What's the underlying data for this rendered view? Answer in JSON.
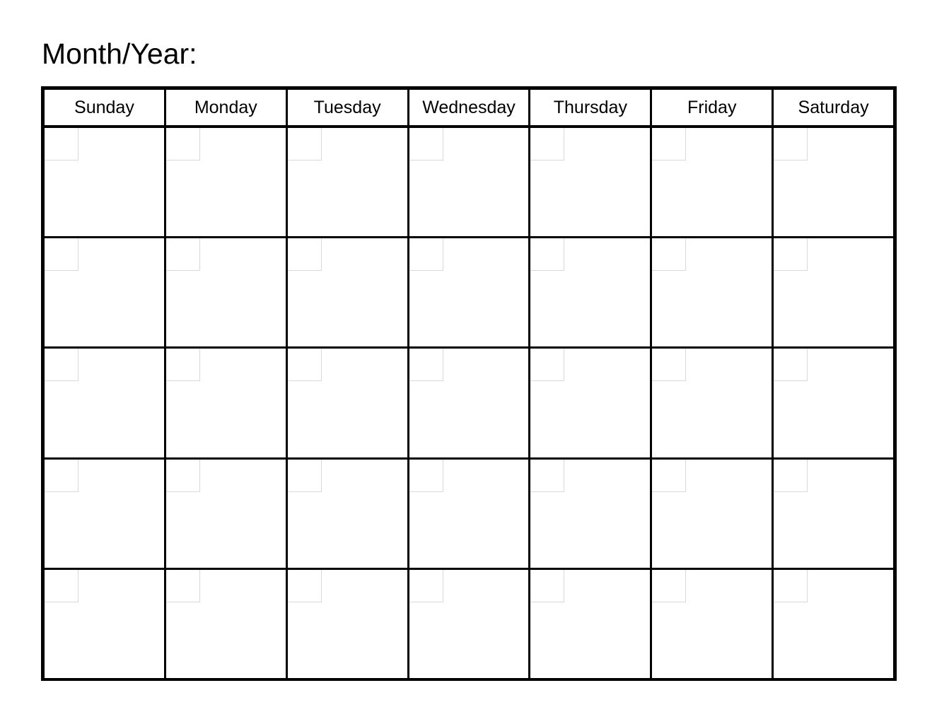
{
  "page": {
    "title_label": "Month/Year:",
    "background_color": "#ffffff",
    "border_color": "#000000",
    "date_box_border_color": "#d9d9d9"
  },
  "calendar": {
    "weekday_headers": [
      "Sunday",
      "Monday",
      "Tuesday",
      "Wednesday",
      "Thursday",
      "Friday",
      "Saturday"
    ],
    "week_count": 5,
    "day_numbers": [
      [
        "",
        "",
        "",
        "",
        "",
        "",
        ""
      ],
      [
        "",
        "",
        "",
        "",
        "",
        "",
        ""
      ],
      [
        "",
        "",
        "",
        "",
        "",
        "",
        ""
      ],
      [
        "",
        "",
        "",
        "",
        "",
        "",
        ""
      ],
      [
        "",
        "",
        "",
        "",
        "",
        "",
        ""
      ]
    ]
  }
}
